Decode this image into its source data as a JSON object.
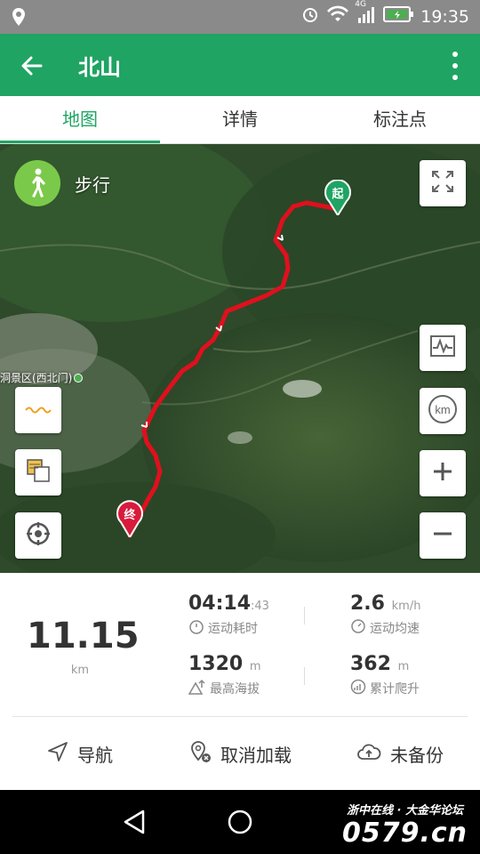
{
  "status_bar": {
    "network": "4G",
    "time": "19:35"
  },
  "app_bar": {
    "title": "北山"
  },
  "tabs": [
    {
      "label": "地图",
      "active": true
    },
    {
      "label": "详情",
      "active": false
    },
    {
      "label": "标注点",
      "active": false
    }
  ],
  "map": {
    "mode_label": "步行",
    "place_label": "洞景区(西北门)",
    "start_marker": "起",
    "end_marker": "终"
  },
  "stats": {
    "distance": {
      "value": "11.15",
      "unit": "km"
    },
    "duration": {
      "value": "04:14",
      "suffix": ":43",
      "label": "运动耗时"
    },
    "avg_speed": {
      "value": "2.6",
      "unit": "km/h",
      "label": "运动均速"
    },
    "max_altitude": {
      "value": "1320",
      "unit": "m",
      "label": "最高海拔"
    },
    "total_climb": {
      "value": "362",
      "unit": "m",
      "label": "累计爬升"
    }
  },
  "actions": {
    "navigate": "导航",
    "cancel_load": "取消加载",
    "not_backed_up": "未备份"
  },
  "watermark": {
    "line1": "浙中在线 · 大金华论坛",
    "line2": "0579.cn"
  },
  "colors": {
    "brand_green": "#1fa463",
    "route_red": "#e0101e",
    "start_green": "#1fa463",
    "end_red": "#d81b3c"
  }
}
